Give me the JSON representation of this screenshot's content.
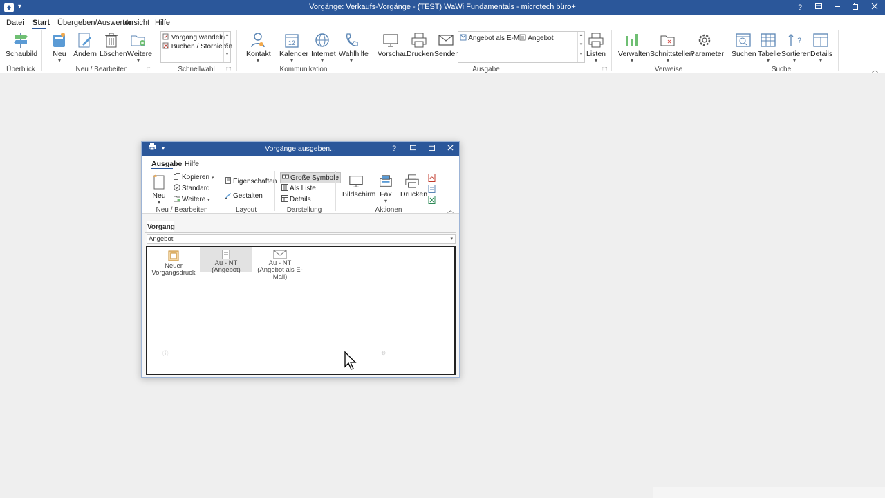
{
  "window": {
    "title": "Vorgänge: Verkaufs-Vorgänge - (TEST) WaWi Fundamentals - microtech büro+",
    "help": "?",
    "qa_arrow": "▾"
  },
  "menu": [
    "Datei",
    "Start",
    "Übergeben/Auswerten",
    "Ansicht",
    "Hilfe"
  ],
  "ribbon": {
    "buttons": {
      "schaubild": "Schaubild",
      "neu": "Neu",
      "aendern": "Ändern",
      "loeschen": "Löschen",
      "weitere": "Weitere",
      "kontakt": "Kontakt",
      "kalender": "Kalender",
      "internet": "Internet",
      "wahlhilfe": "Wahlhilfe",
      "vorschau": "Vorschau",
      "drucken": "Drucken",
      "senden": "Senden",
      "listen": "Listen",
      "verwalten": "Verwalten",
      "schnittstellen": "Schnittstellen",
      "parameter": "Parameter",
      "suchen": "Suchen",
      "tabelle": "Tabelle",
      "sortieren": "Sortieren",
      "details": "Details"
    },
    "schnellwahl_items": [
      "Vorgang wandeln",
      "Buchen / Stornieren"
    ],
    "ausgabe_items": [
      "Angebot als E-Mail",
      "Angebot"
    ],
    "groups": {
      "ueberblick": "Überblick",
      "neu_bearbeiten": "Neu / Bearbeiten",
      "schnellwahl": "Schnellwahl",
      "kommunikation": "Kommunikation",
      "ausgabe": "Ausgabe",
      "verweise": "Verweise",
      "suche": "Suche"
    }
  },
  "dialog": {
    "title": "Vorgänge ausgeben...",
    "help": "?",
    "menu": [
      "Ausgabe",
      "Hilfe"
    ],
    "buttons": {
      "neu": "Neu",
      "kopieren": "Kopieren",
      "standard": "Standard",
      "weitere": "Weitere",
      "eigenschaften": "Eigenschaften",
      "gestalten": "Gestalten",
      "grosse_symbole": "Große Symbole",
      "als_liste": "Als Liste",
      "details": "Details",
      "bildschirm": "Bildschirm",
      "fax": "Fax",
      "drucken": "Drucken"
    },
    "groups": {
      "neu_bearbeiten": "Neu / Bearbeiten",
      "layout": "Layout",
      "darstellung": "Darstellung",
      "aktionen": "Aktionen"
    },
    "tab": "Vorgang",
    "combo_value": "Angebot",
    "items": [
      {
        "line1": "Neuer",
        "line2": "Vorgangsdruck"
      },
      {
        "line1": "Au - NT",
        "line2": "(Angebot)"
      },
      {
        "line1": "Au - NT",
        "line2": "(Angebot als E-Mail)"
      }
    ]
  }
}
